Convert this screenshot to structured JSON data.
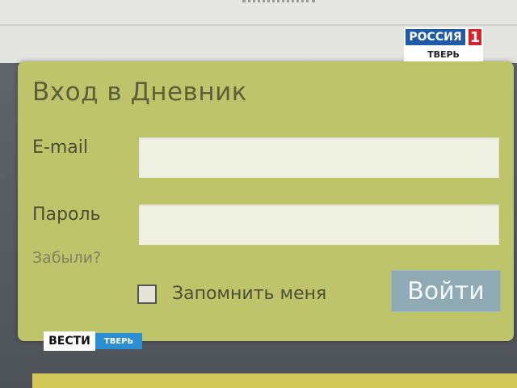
{
  "login_form": {
    "title": "Вход в Дневник",
    "email_label": "E-mail",
    "email_value": "",
    "password_label": "Пароль",
    "password_value": "",
    "forgot_link": "Забыли?",
    "remember_label": "Запомнить меня",
    "remember_checked": false,
    "submit_label": "Войти"
  },
  "overlay": {
    "channel_name": "РОССИЯ",
    "channel_number": "1",
    "channel_region": "ТВЕРЬ",
    "news_name": "ВЕСТИ",
    "news_region": "ТВЕРЬ"
  },
  "colors": {
    "panel": "#bec46a",
    "button": "#8eaab5",
    "channel_blue": "#1f5aa8",
    "channel_red": "#d6232a",
    "news_blue": "#2d8fd3"
  }
}
